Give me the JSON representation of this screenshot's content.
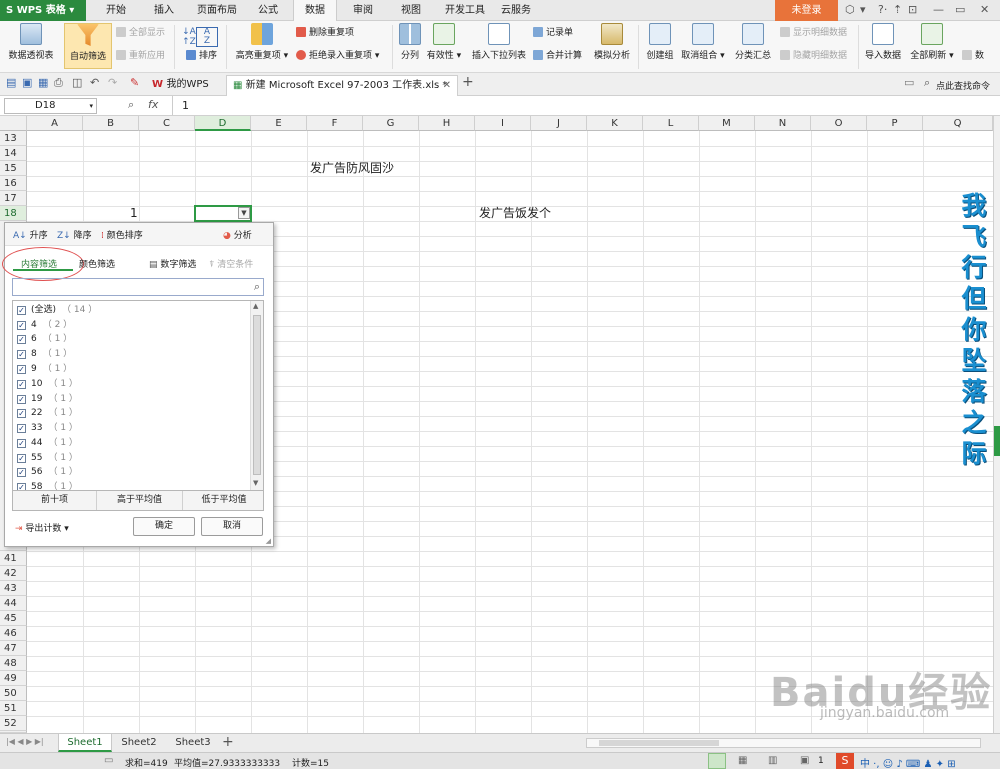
{
  "app": {
    "name": "WPS 表格"
  },
  "menu": {
    "items": [
      "开始",
      "插入",
      "页面布局",
      "公式",
      "数据",
      "审阅",
      "视图",
      "开发工具",
      "云服务"
    ],
    "active": "数据",
    "login": "未登录"
  },
  "ribbon": {
    "pivot": "数据透视表",
    "autofilter": "自动筛选",
    "show_all": "全部显示",
    "reapply": "重新应用",
    "sort": "排序",
    "highlight_dup": "高亮重复项",
    "delete_dup": "删除重复项",
    "reject_dup": "拒绝录入重复项",
    "split": "分列",
    "validity": "有效性",
    "dropdown": "插入下拉列表",
    "record": "记录单",
    "merge_calc": "合并计算",
    "simulate": "模拟分析",
    "create_group": "创建组",
    "ungroup": "取消组合",
    "subtotal": "分类汇总",
    "show_detail": "显示明细数据",
    "hide_detail": "隐藏明细数据",
    "import": "导入数据",
    "refresh_all": "全部刷新",
    "data_conn": "数"
  },
  "toolbar": {
    "tabs": [
      "我的WPS",
      "新建 Microsoft Excel 97-2003 工作表.xls *"
    ],
    "find_cmd": "点此查找命令"
  },
  "formula_bar": {
    "cell_ref": "D18",
    "fx": "fx",
    "value": "1"
  },
  "grid": {
    "columns": [
      "A",
      "B",
      "C",
      "D",
      "E",
      "F",
      "G",
      "H",
      "I",
      "J",
      "K",
      "L",
      "M",
      "N",
      "O",
      "P",
      "Q"
    ],
    "selected_column": "D",
    "rows_top": [
      "13",
      "14",
      "15",
      "16",
      "17",
      "18"
    ],
    "rows_bottom": [
      "41",
      "42",
      "43",
      "44",
      "45",
      "46",
      "47",
      "48",
      "49",
      "50",
      "51",
      "52",
      "53"
    ],
    "selected_row": "18",
    "cells": {
      "B18": "1",
      "F15": "发广告防风固沙",
      "I18": "发广告饭发个"
    }
  },
  "filter_panel": {
    "asc": "升序",
    "desc": "降序",
    "color_sort": "颜色排序",
    "analyze": "分析",
    "tab_content": "内容筛选",
    "tab_color": "颜色筛选",
    "number_filter": "数字筛选",
    "clear": "清空条件",
    "items": [
      {
        "label": "(全选)",
        "count": "（ 14 ）"
      },
      {
        "label": "4",
        "count": "（ 2 ）"
      },
      {
        "label": "6",
        "count": "（ 1 ）"
      },
      {
        "label": "8",
        "count": "（ 1 ）"
      },
      {
        "label": "9",
        "count": "（ 1 ）"
      },
      {
        "label": "10",
        "count": "（ 1 ）"
      },
      {
        "label": "19",
        "count": "（ 1 ）"
      },
      {
        "label": "22",
        "count": "（ 1 ）"
      },
      {
        "label": "33",
        "count": "（ 1 ）"
      },
      {
        "label": "44",
        "count": "（ 1 ）"
      },
      {
        "label": "55",
        "count": "（ 1 ）"
      },
      {
        "label": "56",
        "count": "（ 1 ）"
      },
      {
        "label": "58",
        "count": "（ 1 ）"
      }
    ],
    "top10": "前十项",
    "above_avg": "高于平均值",
    "below_avg": "低于平均值",
    "export_count": "导出计数",
    "ok": "确定",
    "cancel": "取消"
  },
  "sheets": {
    "tabs": [
      "Sheet1",
      "Sheet2",
      "Sheet3"
    ],
    "active": "Sheet1"
  },
  "status": {
    "sum": "求和=419",
    "avg": "平均值=27.9333333333",
    "count": "计数=15",
    "zoom": "1"
  },
  "overlay": {
    "vertical_text": "我飞行但你坠落之际",
    "watermark": "Baidu经验",
    "watermark_url": "jingyan.baidu.com"
  },
  "colors": {
    "accent": "#2e9a45",
    "brand": "#2b8a3e",
    "login": "#e8733a"
  }
}
